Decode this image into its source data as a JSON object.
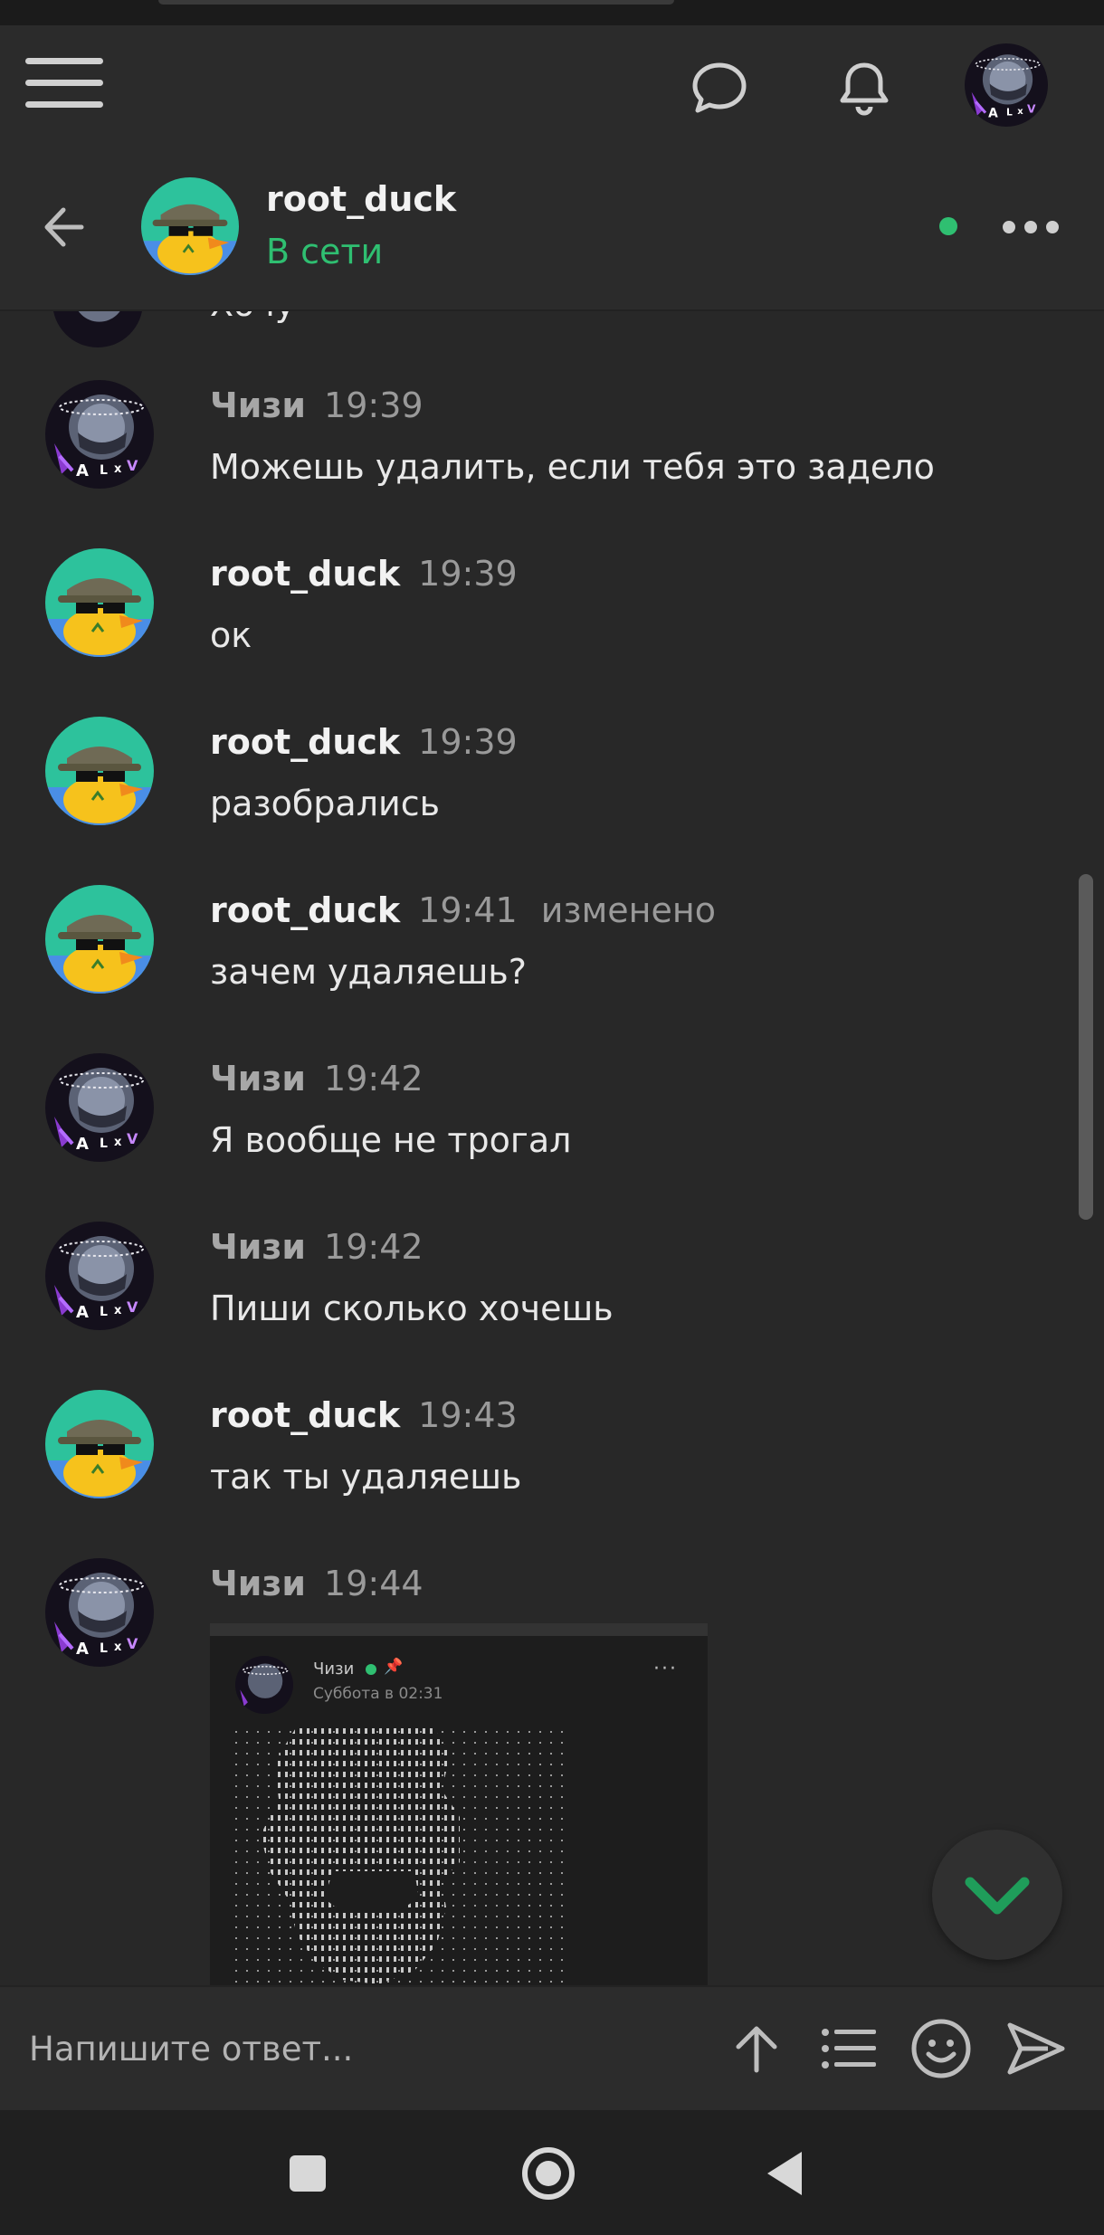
{
  "header": {
    "contact_name": "root_duck",
    "contact_status": "В сети"
  },
  "partial_message": {
    "text": "Хочу"
  },
  "messages": [
    {
      "author": "Чизи",
      "author_type": "chizi",
      "time": "19:39",
      "edited": "",
      "text": "Можешь удалить, если тебя это задело"
    },
    {
      "author": "root_duck",
      "author_type": "duck",
      "time": "19:39",
      "edited": "",
      "text": "ок"
    },
    {
      "author": "root_duck",
      "author_type": "duck",
      "time": "19:39",
      "edited": "",
      "text": "разобрались"
    },
    {
      "author": "root_duck",
      "author_type": "duck",
      "time": "19:41",
      "edited": "изменено",
      "text": "зачем удаляешь?"
    },
    {
      "author": "Чизи",
      "author_type": "chizi",
      "time": "19:42",
      "edited": "",
      "text": "Я вообще не трогал"
    },
    {
      "author": "Чизи",
      "author_type": "chizi",
      "time": "19:42",
      "edited": "",
      "text": "Пиши сколько хочешь"
    },
    {
      "author": "root_duck",
      "author_type": "duck",
      "time": "19:43",
      "edited": "",
      "text": "так ты удаляешь"
    },
    {
      "author": "Чизи",
      "author_type": "chizi",
      "time": "19:44",
      "edited": "",
      "text": ""
    }
  ],
  "embed": {
    "author": "Чизи",
    "date": "Суббота в 02:31",
    "more": "···"
  },
  "composer": {
    "placeholder": "Напишите ответ..."
  },
  "icons": {
    "topbar": [
      "menu-icon",
      "chat-bubble-icon",
      "bell-icon",
      "user-avatar"
    ],
    "composer": [
      "upload-icon",
      "list-icon",
      "emoji-icon",
      "send-icon"
    ],
    "navbar": [
      "recents-square-icon",
      "home-circle-icon",
      "back-triangle-icon"
    ]
  },
  "colors": {
    "background": "#282828",
    "online": "#2fbf71",
    "accent_check": "#1f9d5a"
  }
}
